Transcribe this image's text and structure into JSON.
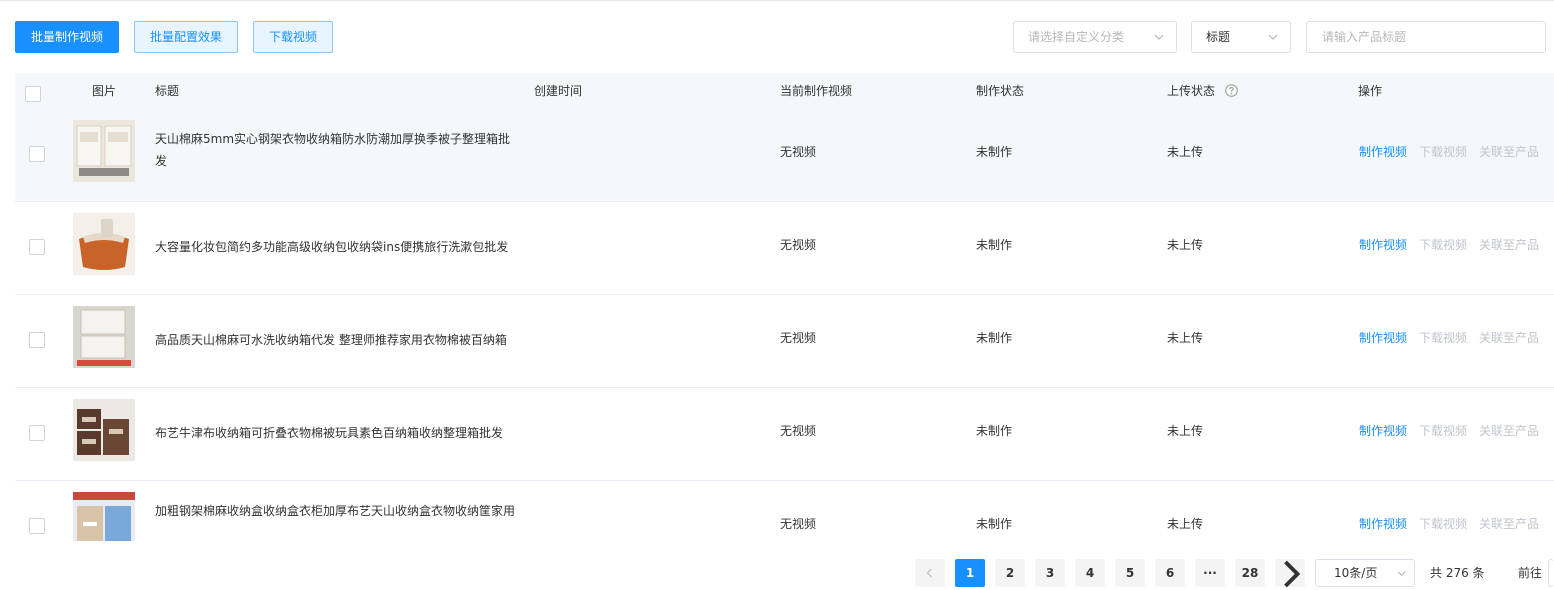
{
  "toolbar": {
    "batch_make_label": "批量制作视频",
    "batch_config_label": "批量配置效果",
    "download_label": "下载视频",
    "category_placeholder": "请选择自定义分类",
    "field_select_value": "标题",
    "search_placeholder": "请输入产品标题"
  },
  "table": {
    "headers": {
      "image": "图片",
      "title": "标题",
      "created": "创建时间",
      "current_video": "当前制作视频",
      "make_status": "制作状态",
      "upload_status": "上传状态",
      "actions": "操作"
    },
    "action_labels": {
      "make": "制作视频",
      "download": "下载视频",
      "link": "关联至产品"
    },
    "rows": [
      {
        "title": "天山棉麻5mm实心钢架衣物收纳箱防水防潮加厚换季被子整理箱批发",
        "created": "",
        "video": "无视频",
        "make_status": "未制作",
        "upload_status": "未上传"
      },
      {
        "title": "大容量化妆包简约多功能高级收纳包收纳袋ins便携旅行洗漱包批发",
        "created": "",
        "video": "无视频",
        "make_status": "未制作",
        "upload_status": "未上传"
      },
      {
        "title": "高品质天山棉麻可水洗收纳箱代发 整理师推荐家用衣物棉被百纳箱",
        "created": "",
        "video": "无视频",
        "make_status": "未制作",
        "upload_status": "未上传"
      },
      {
        "title": "布艺牛津布收纳箱可折叠衣物棉被玩具素色百纳箱收纳整理箱批发",
        "created": "",
        "video": "无视频",
        "make_status": "未制作",
        "upload_status": "未上传"
      },
      {
        "title": "加粗钢架棉麻收纳盒收纳盒衣柜加厚布艺天山收纳盒衣物收纳筐家用",
        "created": "",
        "video": "无视频",
        "make_status": "未制作",
        "upload_status": "未上传"
      }
    ]
  },
  "pagination": {
    "pages": [
      "1",
      "2",
      "3",
      "4",
      "5",
      "6",
      "···",
      "28"
    ],
    "current_page": "1",
    "page_size": "10条/页",
    "total": "共 276 条",
    "goto": "前往"
  },
  "colors": {
    "primary": "#1890ff",
    "disabled": "#c0c4cc",
    "header_bg": "#f5f7fa"
  }
}
